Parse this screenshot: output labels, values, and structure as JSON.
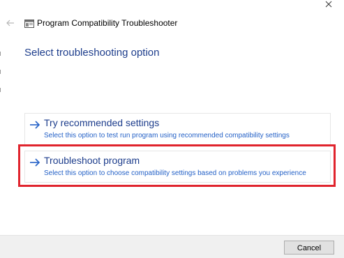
{
  "window": {
    "title": "Program Compatibility Troubleshooter"
  },
  "heading": "Select troubleshooting option",
  "options": [
    {
      "title": "Try recommended settings",
      "description": "Select this option to test run program using recommended compatibility settings"
    },
    {
      "title": "Troubleshoot program",
      "description": "Select this option to choose compatibility settings based on problems you experience"
    }
  ],
  "footer": {
    "cancel_label": "Cancel"
  },
  "colors": {
    "heading": "#1d3d8c",
    "description": "#2461c7",
    "highlight": "#e0242d"
  },
  "icons": {
    "close": "close-icon",
    "back": "back-arrow-icon",
    "app": "program-compatibility-icon",
    "option_arrow": "right-arrow-icon"
  }
}
